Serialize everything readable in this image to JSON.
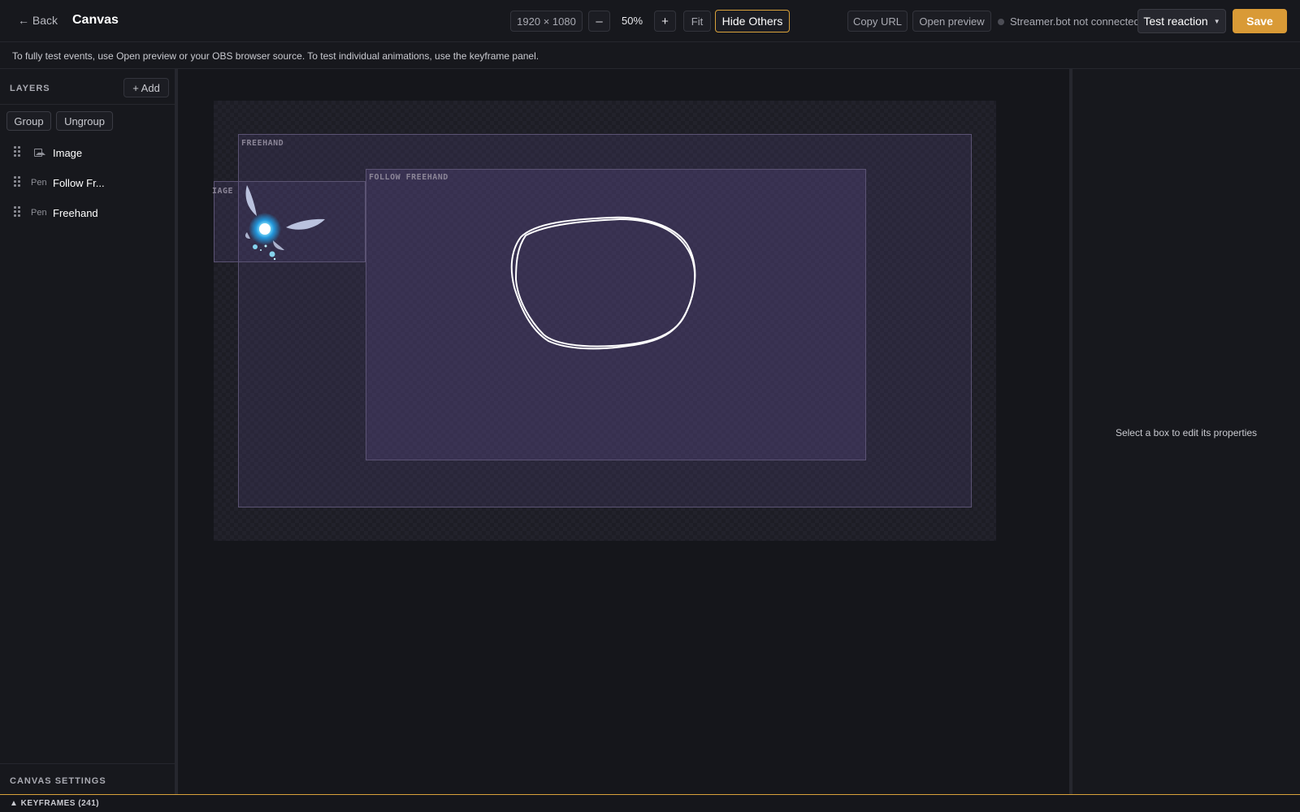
{
  "header": {
    "back_label": "← Back",
    "title": "Canvas",
    "resolution": "1920 × 1080",
    "zoom_minus": "–",
    "zoom_value": "50%",
    "zoom_plus": "+",
    "fit_label": "Fit",
    "hide_others_label": "Hide Others",
    "copy_url_label": "Copy URL",
    "open_preview_label": "Open preview",
    "connection_status": "Streamer.bot not connected",
    "test_reaction_label": "Test reaction",
    "save_label": "Save"
  },
  "info_text": "To fully test events, use Open preview or your OBS browser source. To test individual animations, use the keyframe panel.",
  "layers_panel": {
    "title": "LAYERS",
    "add_label": "+ Add",
    "group_label": "Group",
    "ungroup_label": "Ungroup",
    "items": [
      {
        "type": "",
        "icon": "image-icon",
        "name": "Image"
      },
      {
        "type": "Pen",
        "icon": "",
        "name": "Follow Fr..."
      },
      {
        "type": "Pen",
        "icon": "",
        "name": "Freehand"
      }
    ],
    "canvas_settings_title": "CANVAS SETTINGS"
  },
  "stage": {
    "freehand_label": "FREEHAND",
    "image_label": "IAGE",
    "follow_label": "FOLLOW FREEHAND"
  },
  "right_panel": {
    "hint": "Select a box to edit its properties"
  },
  "keyframes": {
    "label": "▲ KEYFRAMES (241)"
  },
  "colors": {
    "accent": "#d9a23b",
    "save": "#d99a36",
    "background": "#15161b",
    "panel": "#17181d",
    "layer_box": "#6856a0"
  }
}
